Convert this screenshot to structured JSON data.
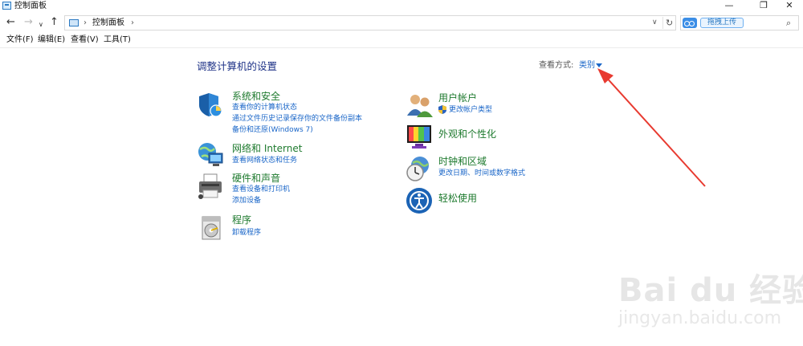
{
  "window": {
    "title": "控制面板",
    "minimize_glyph": "—",
    "restore_glyph": "❐",
    "close_glyph": "✕"
  },
  "address_bar": {
    "back_glyph": "←",
    "forward_glyph": "→",
    "recent_glyph": "∨",
    "up_glyph": "↑",
    "sep_glyph": "›",
    "path": [
      "控制面板"
    ],
    "dropdown_glyph": "∨",
    "refresh_glyph": "↻"
  },
  "search": {
    "upload_label": "拖拽上传",
    "search_glyph": "⌕"
  },
  "menu": [
    "文件(F)",
    "编辑(E)",
    "查看(V)",
    "工具(T)"
  ],
  "main": {
    "heading": "调整计算机的设置",
    "view_by_label": "查看方式:",
    "view_by_value": "类别"
  },
  "categories": [
    {
      "title": "系统和安全",
      "links": [
        "查看你的计算机状态",
        "通过文件历史记录保存你的文件备份副本",
        "备份和还原(Windows 7)"
      ]
    },
    {
      "title": "网络和 Internet",
      "links": [
        "查看网络状态和任务"
      ]
    },
    {
      "title": "硬件和声音",
      "links": [
        "查看设备和打印机",
        "添加设备"
      ]
    },
    {
      "title": "程序",
      "links": [
        "卸载程序"
      ]
    },
    {
      "title": "用户帐户",
      "links": [
        "更改帐户类型"
      ]
    },
    {
      "title": "外观和个性化",
      "links": []
    },
    {
      "title": "时钟和区域",
      "links": [
        "更改日期、时间或数字格式"
      ]
    },
    {
      "title": "轻松使用",
      "links": []
    }
  ],
  "colors": {
    "heading": "#1e3287",
    "category_title": "#1e7a2e",
    "link": "#1a66c8",
    "arrow": "#e83a30"
  },
  "watermark": {
    "line1": "Bai du 经验",
    "line2": "jingyan.baidu.com"
  }
}
